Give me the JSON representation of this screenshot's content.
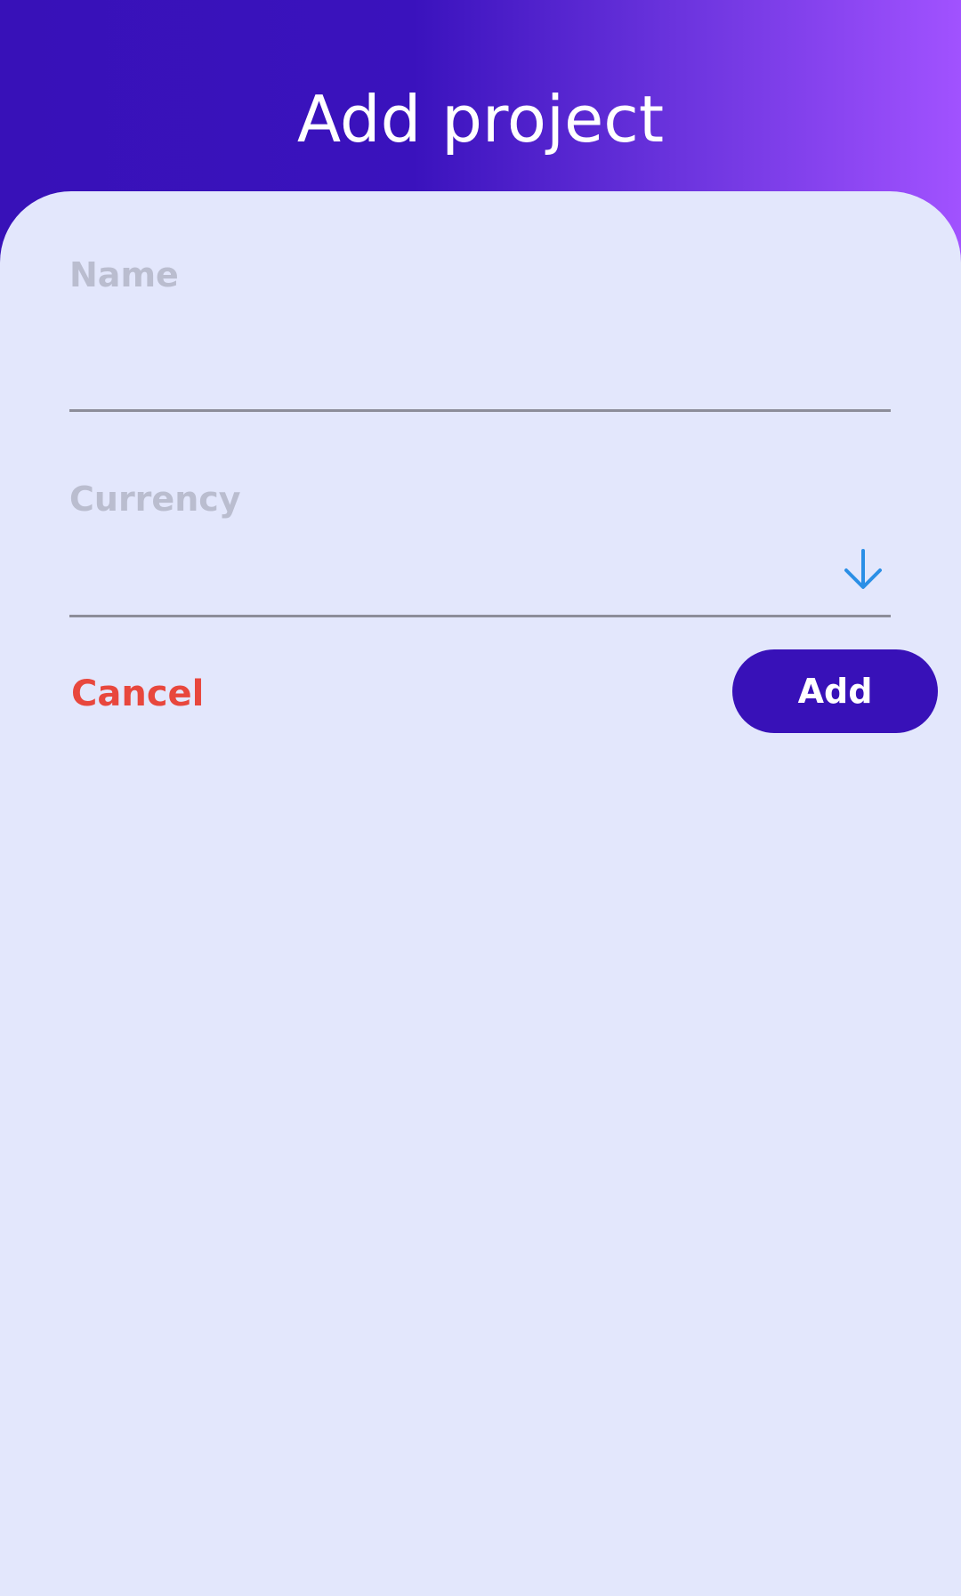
{
  "header": {
    "title": "Add project"
  },
  "form": {
    "name": {
      "label": "Name",
      "value": ""
    },
    "currency": {
      "label": "Currency",
      "value": "",
      "dropdown_icon": "arrow-down-icon"
    }
  },
  "actions": {
    "cancel_label": "Cancel",
    "add_label": "Add"
  },
  "colors": {
    "primary": "#3811b8",
    "gradient_end": "#a152ff",
    "background": "#e3e7fc",
    "cancel": "#e8473d",
    "dropdown_icon": "#2b8fe6",
    "label": "#babdcf"
  }
}
